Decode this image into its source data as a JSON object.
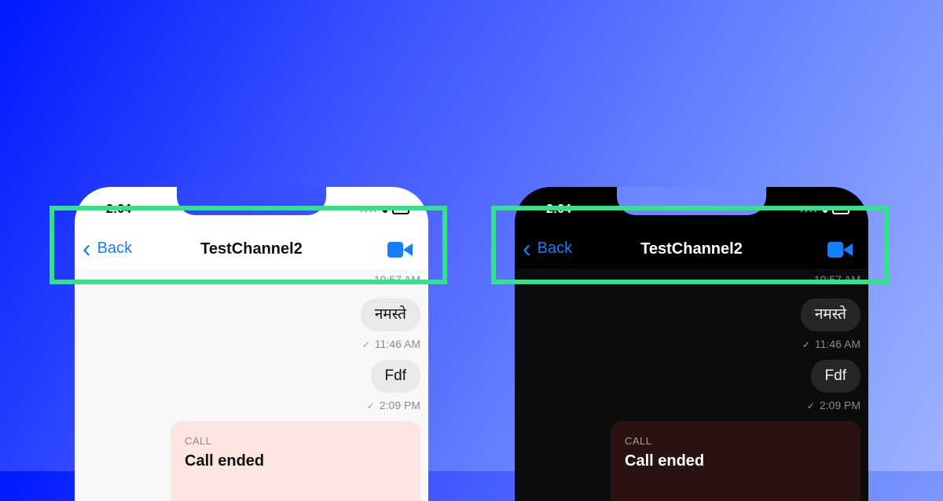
{
  "status_bar": {
    "time": "2:04"
  },
  "navbar": {
    "back_label": "Back",
    "title": "TestChannel2"
  },
  "messages": [
    {
      "text": "नमस्ते",
      "time": "11:46 AM"
    },
    {
      "text": "Fdf",
      "time": "2:09 PM"
    }
  ],
  "partial_timestamp": "10:57 AM",
  "call_card": {
    "label": "CALL",
    "title": "Call ended"
  },
  "colors": {
    "accent": "#147efb",
    "highlight": "#33e28a"
  }
}
